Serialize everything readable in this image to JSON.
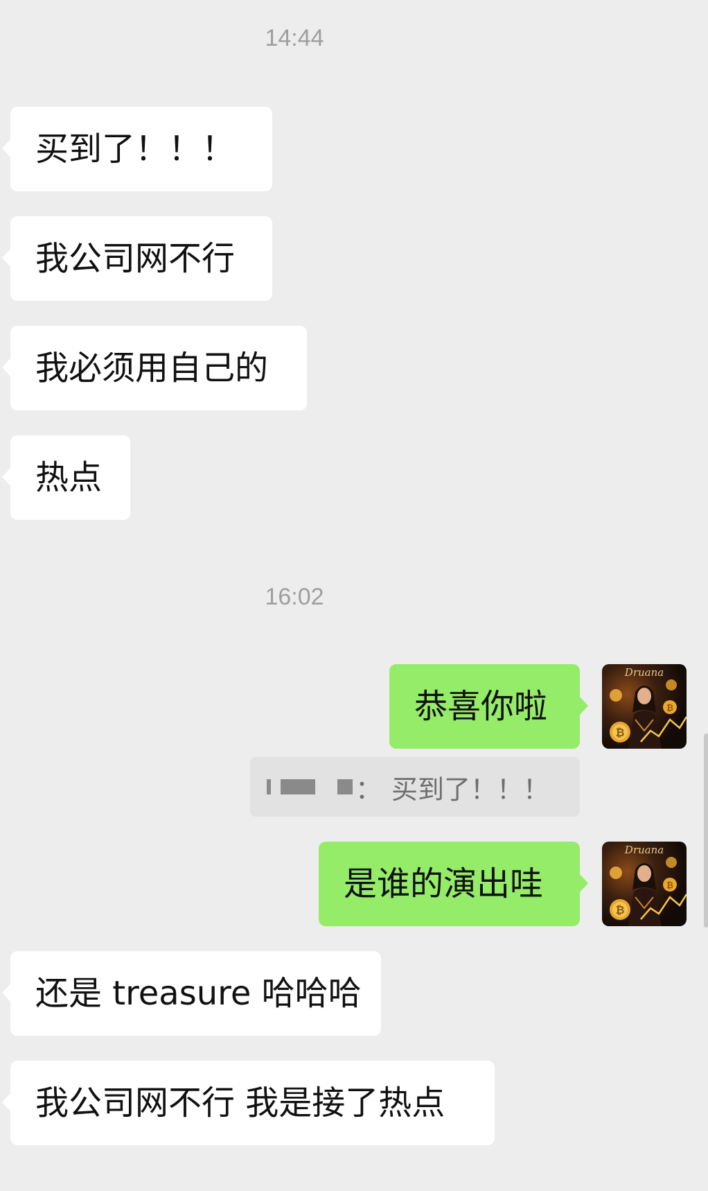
{
  "timestamps": [
    "14:44",
    "16:02"
  ],
  "messages": [
    {
      "side": "in",
      "text": "买到了！！！"
    },
    {
      "side": "in",
      "text": "我公司网不行"
    },
    {
      "side": "in",
      "text": "我必须用自己的"
    },
    {
      "side": "in",
      "text": "热点"
    },
    {
      "side": "out",
      "text": "恭喜你啦"
    },
    {
      "side": "out",
      "text": "是谁的演出哇"
    },
    {
      "side": "in",
      "text": "还是 treasure 哈哈哈"
    },
    {
      "side": "in",
      "text": "我公司网不行 我是接了热点"
    }
  ],
  "quote": {
    "separator": "：",
    "text": "买到了！！！"
  },
  "avatar": {
    "label": "Druana",
    "icon": "bitcoin-coin-icon"
  },
  "colors": {
    "background": "#EDEDED",
    "incoming_bubble": "#FFFFFF",
    "outgoing_bubble": "#95EC69",
    "quote_background": "#E2E2E2",
    "timestamp_text": "#9E9E9E"
  }
}
